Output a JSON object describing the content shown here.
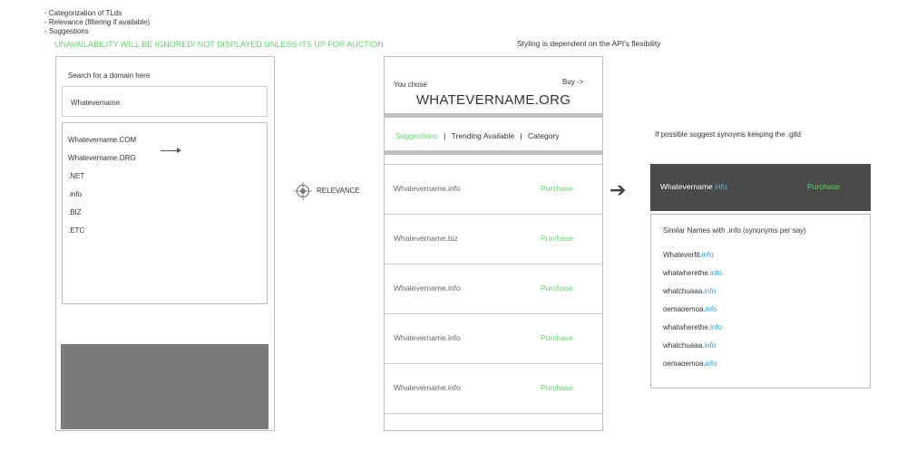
{
  "notes": {
    "line1": "- Categorization of TLds",
    "line2": "- Relevance (filtering if available)",
    "line3": "- Suggestions",
    "warning": "UNAVAILABILITY WILL BE IGNORED/ NOT DISPLAYED UNLESS ITS UP FOR AUCTION",
    "styling": "Styling is dependent on the API's flexibility"
  },
  "search_panel": {
    "label": "Search for a domain here",
    "input_value": "Whatevername",
    "results": [
      "Whatevername.COM",
      "Whatevername.ORG",
      ".NET",
      ".info",
      ".BIZ",
      ".ETC"
    ]
  },
  "relevance": {
    "label": "RELEVANCE"
  },
  "choice_panel": {
    "you_chose": "You chose",
    "buy": "Buy ->",
    "domain": "WHATEVERNAME.ORG",
    "tabs": {
      "suggestions": "Suggestions",
      "sep1": "|",
      "trending": "Trending Available",
      "sep2": "|",
      "category": "Category"
    },
    "rows": [
      {
        "name": "Whatevername.info",
        "action": "Purchase"
      },
      {
        "name": "Whatevername.biz",
        "action": "Purchase"
      },
      {
        "name": "Whatevername.info",
        "action": "Purchase"
      },
      {
        "name": "Whatevername.info",
        "action": "Purchase"
      },
      {
        "name": "Whatevername.info",
        "action": "Purchase"
      }
    ]
  },
  "synonym_panel": {
    "caption": "If possible suggest synoyms keeping the .gtld",
    "selected": {
      "base": "Whatevername ",
      "tld": "info",
      "action": "Purchase"
    },
    "similar_label": "Similar Names with .info  (synonyms per say)",
    "items": [
      {
        "base": "Whateverfit.",
        "tld": "info"
      },
      {
        "base": "whatwherethe.",
        "tld": "info"
      },
      {
        "base": "whatchuaaa.",
        "tld": "info"
      },
      {
        "base": "oemaoemoa.",
        "tld": "info"
      },
      {
        "base": "whatwherethe.",
        "tld": "info"
      },
      {
        "base": "whatchuaaa.",
        "tld": "info"
      },
      {
        "base": "oemaoemoa.",
        "tld": "info"
      }
    ]
  },
  "colors": {
    "accent_green": "#5fd46a",
    "accent_blue": "#2e9fe0",
    "dark_bar": "#4a4a4a",
    "placeholder_gray": "#7a7a7a"
  },
  "icons": {
    "relevance": "crosshair-icon",
    "flow_arrow": "arrow-right-icon",
    "list_arrow": "arrow-right-icon"
  }
}
